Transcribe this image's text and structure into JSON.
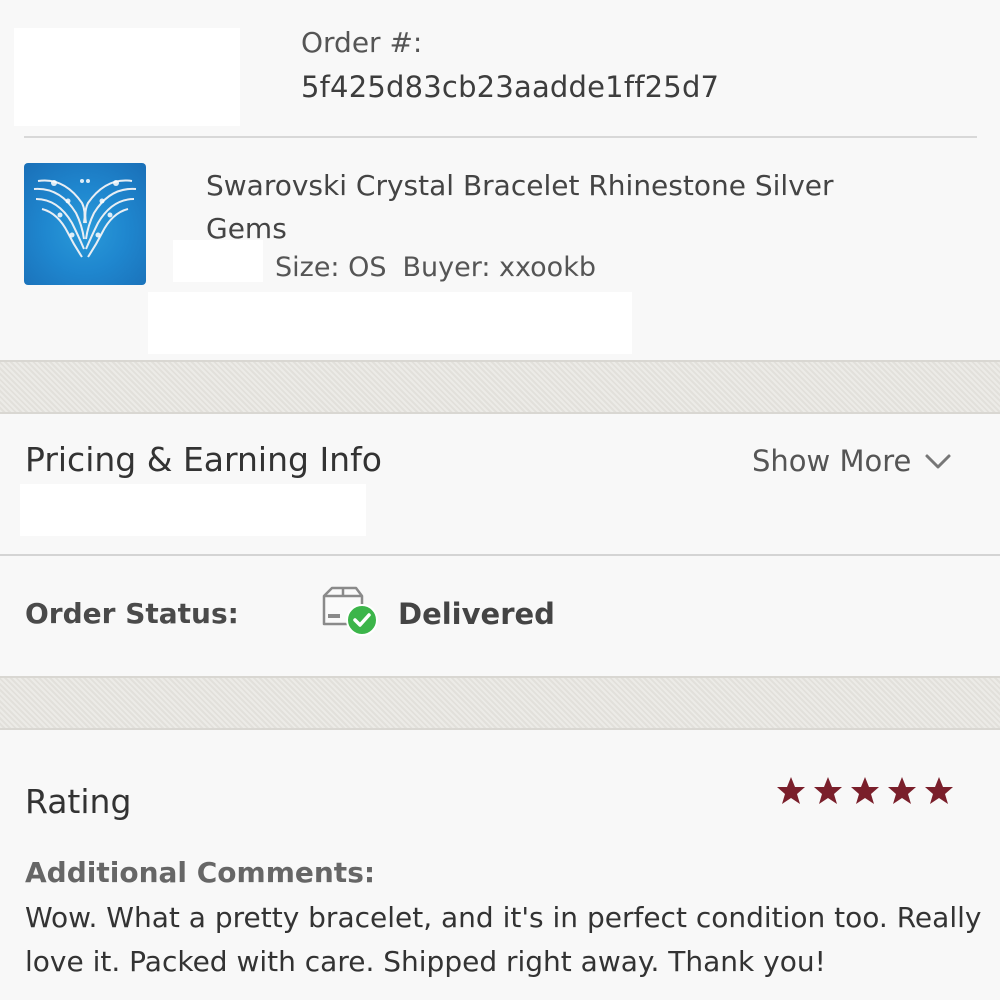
{
  "order": {
    "label": "Order #:",
    "number": "5f425d83cb23aadde1ff25d7"
  },
  "item": {
    "title": "Swarovski Crystal Bracelet Rhinestone Silver Gems",
    "size": "Size: OS",
    "buyer": "Buyer: xxookb",
    "image_icon": "bracelet-photo"
  },
  "pricing": {
    "title": "Pricing & Earning Info",
    "show_more": "Show More",
    "toggle_icon": "chevron-down-icon"
  },
  "status": {
    "label": "Order Status:",
    "value": "Delivered",
    "icon": "box-delivered-icon",
    "icon_color": "#3cb54a"
  },
  "rating": {
    "title": "Rating",
    "stars": 5,
    "max_stars": 5,
    "star_color": "#7a1f2b",
    "comments_label": "Additional Comments:",
    "comment": "Wow. What a pretty bracelet, and it's in perfect condition too. Really love it. Packed with care. Shipped right away. Thank you!"
  }
}
